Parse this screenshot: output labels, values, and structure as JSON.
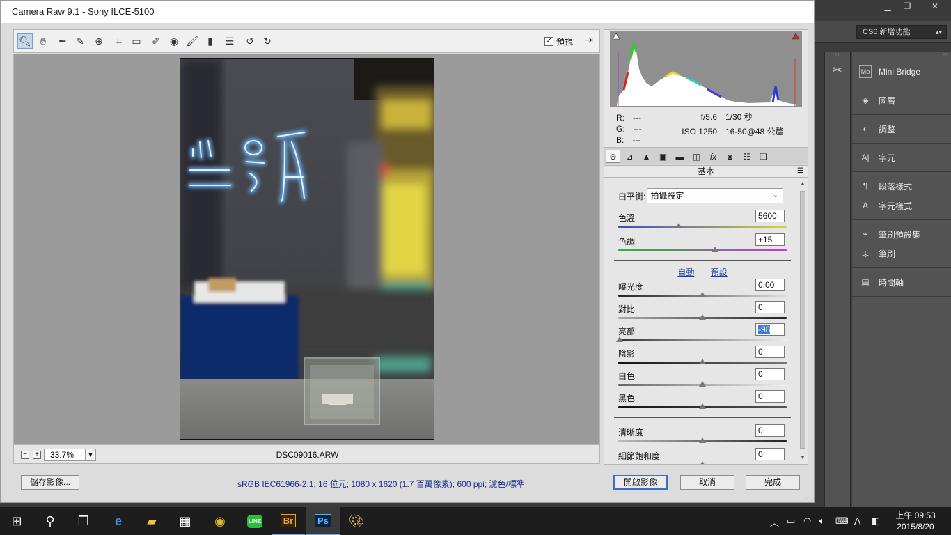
{
  "dialog": {
    "title": "Camera Raw 9.1  -  Sony ILCE-5100",
    "preview_label": "預視",
    "preview_checked": true,
    "zoom_value": "33.7%",
    "filename": "DSC09016.ARW",
    "save_button": "儲存影像...",
    "workflow_link": "sRGB IEC61966-2.1; 16 位元; 1080 x 1620 (1.7 百萬像素); 600 ppi; 濾色/標準",
    "open_button": "開啟影像",
    "cancel_button": "取消",
    "done_button": "完成"
  },
  "toolbar": {
    "tools": [
      "zoom-tool",
      "hand-tool",
      "white-balance-tool",
      "color-sampler-tool",
      "targeted-adjustment-tool",
      "crop-tool",
      "straighten-tool",
      "spot-removal-tool",
      "red-eye-tool",
      "adjustment-brush",
      "graduated-filter",
      "radial-filter",
      "preferences",
      "rotate-ccw",
      "rotate-cw"
    ],
    "active_tool": "zoom-tool"
  },
  "readout": {
    "r_label": "R:",
    "r_value": "---",
    "g_label": "G:",
    "g_value": "---",
    "b_label": "B:",
    "b_value": "---",
    "aperture": "f/5.6",
    "shutter": "1/30 秒",
    "iso": "ISO 1250",
    "lens": "16-50@48 公釐"
  },
  "panel": {
    "title": "基本",
    "tabs": [
      "basic",
      "tone-curve",
      "detail",
      "hsl",
      "split-toning",
      "lens-corrections",
      "effects",
      "camera-calibration",
      "presets",
      "snapshots"
    ],
    "white_balance_label": "白平衡:",
    "white_balance_value": "拍攝設定",
    "auto_link": "自動",
    "default_link": "預設",
    "sliders": {
      "temperature": {
        "label": "色溫",
        "value": "5600",
        "pos": 0.36
      },
      "tint": {
        "label": "色調",
        "value": "+15",
        "pos": 0.575
      },
      "exposure": {
        "label": "曝光度",
        "value": "0.00",
        "pos": 0.5
      },
      "contrast": {
        "label": "對比",
        "value": "0",
        "pos": 0.5
      },
      "highlights": {
        "label": "亮部",
        "value": "-98",
        "pos": 0.01
      },
      "shadows": {
        "label": "陰影",
        "value": "0",
        "pos": 0.5
      },
      "whites": {
        "label": "白色",
        "value": "0",
        "pos": 0.5
      },
      "blacks": {
        "label": "黑色",
        "value": "0",
        "pos": 0.5
      },
      "clarity": {
        "label": "清晰度",
        "value": "0",
        "pos": 0.5
      },
      "vibrance": {
        "label": "細節飽和度",
        "value": "0",
        "pos": 0.5
      }
    }
  },
  "photoshop": {
    "workspace": "CS6 新增功能",
    "panels": [
      {
        "icon": "mini-bridge-icon",
        "label": "Mini Bridge"
      },
      {
        "icon": "layers-icon",
        "label": "圖層"
      },
      {
        "icon": "adjustments-icon",
        "label": "調整"
      },
      {
        "icon": "character-icon",
        "label": "字元"
      },
      {
        "icon": "paragraph-styles-icon",
        "label": "段落樣式"
      },
      {
        "icon": "character-styles-icon",
        "label": "字元樣式"
      },
      {
        "icon": "brush-presets-icon",
        "label": "筆刷預設集"
      },
      {
        "icon": "brush-icon",
        "label": "筆刷"
      },
      {
        "icon": "timeline-icon",
        "label": "時間軸"
      }
    ]
  },
  "taskbar": {
    "apps": [
      "start",
      "search",
      "task-view",
      "edge",
      "file-explorer",
      "store",
      "chrome",
      "line",
      "bridge",
      "photoshop",
      "paint"
    ],
    "bridge_label": "Br",
    "photoshop_label": "Ps",
    "line_label": "LINE",
    "ime_label": "A",
    "clock_time": "上午 09:53",
    "clock_date": "2015/8/20"
  },
  "colors": {
    "dialog_bg": "#dcdcdc",
    "canvas_bg": "#9b9b9b",
    "ps_panel": "#535353",
    "link": "#1a2e8a",
    "taskbar": "#1d1d1d"
  }
}
